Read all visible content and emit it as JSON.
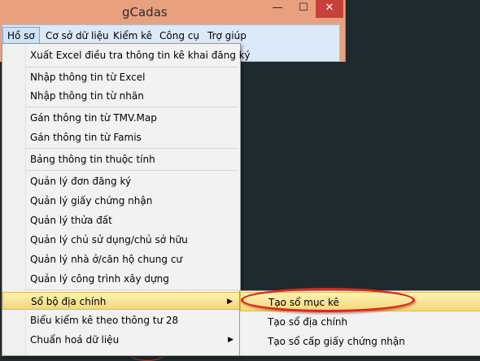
{
  "window": {
    "title": "gCadas",
    "controls": {
      "minimize": "—",
      "maximize": "☐",
      "close": "✕"
    }
  },
  "menubar": {
    "items": [
      {
        "label": "Hồ sơ"
      },
      {
        "label": "Cơ sở dữ liệu"
      },
      {
        "label": "Kiểm kê"
      },
      {
        "label": "Công cụ"
      },
      {
        "label": "Trợ giúp"
      }
    ]
  },
  "dropdown": {
    "items": [
      {
        "label": "Xuất Excel điều tra thông tin kê khai đăng ký"
      },
      {
        "label": "Nhập thông tin từ Excel"
      },
      {
        "label": "Nhập thông tin từ nhãn"
      },
      {
        "label": "Gán thông tin từ TMV.Map"
      },
      {
        "label": "Gán thông tin từ Famis"
      },
      {
        "label": "Bảng thông tin thuộc tính"
      },
      {
        "label": "Quản lý đơn đăng ký"
      },
      {
        "label": "Quản lý giấy chứng nhận"
      },
      {
        "label": "Quản lý thửa đất"
      },
      {
        "label": "Quản lý chủ sử dụng/chủ sở hữu"
      },
      {
        "label": "Quản lý nhà ở/căn hộ chung cư"
      },
      {
        "label": "Quản lý công trình xây dựng"
      },
      {
        "label": "Sổ bộ địa chính"
      },
      {
        "label": "Biểu kiểm kê theo thông tư 28"
      },
      {
        "label": "Chuẩn hoá dữ liệu"
      }
    ],
    "submenu_arrow": "▶"
  },
  "submenu": {
    "items": [
      {
        "label": "Tạo sổ mục kê"
      },
      {
        "label": "Tạo sổ địa chính"
      },
      {
        "label": "Tạo sổ cấp giấy chứng nhận"
      }
    ]
  },
  "colors": {
    "title_bar": "#e9a07f",
    "close_button": "#c7413a",
    "menu_highlight": "#f3d77a",
    "annotation_ellipse": "#e0261f"
  }
}
